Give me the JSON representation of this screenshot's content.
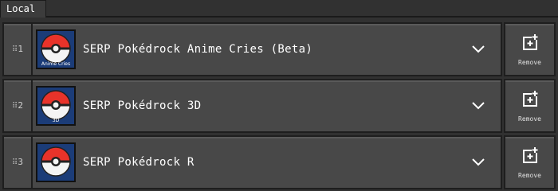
{
  "tabs": {
    "local_label": "Local"
  },
  "packs": [
    {
      "index": "1",
      "name": "SERP Pokédrock Anime Cries (Beta)",
      "icon_caption": "Anime Cries",
      "remove_label": "Remove"
    },
    {
      "index": "2",
      "name": "SERP Pokédrock 3D",
      "icon_caption": "3D",
      "remove_label": "Remove"
    },
    {
      "index": "3",
      "name": "SERP Pokédrock R",
      "icon_caption": "",
      "remove_label": "Remove"
    }
  ],
  "icons": {
    "drag": "drag-handle-icon",
    "pack": "pokeball-icon",
    "expand": "chevron-down-icon",
    "remove": "remove-pack-icon"
  },
  "colors": {
    "background": "#313131",
    "row": "#484848",
    "border": "#1e1e1e",
    "icon_bg": "#1b3c78",
    "pokeball_red": "#e8332a"
  }
}
